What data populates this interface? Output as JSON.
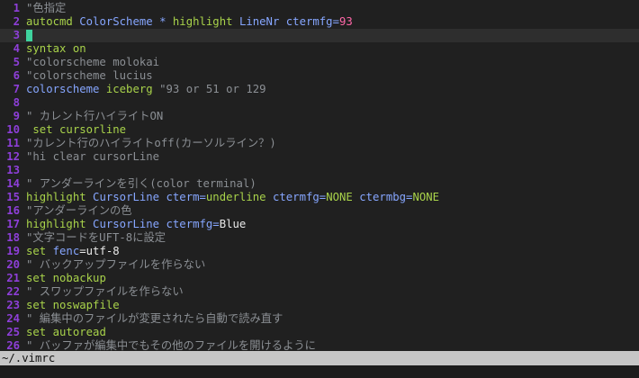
{
  "editor": {
    "lines": [
      [
        {
          "t": "\"色指定",
          "c": "t-c"
        }
      ],
      [
        {
          "t": "autocmd ",
          "c": "t-k"
        },
        {
          "t": "ColorScheme * ",
          "c": "t-h"
        },
        {
          "t": "highlight ",
          "c": "t-k"
        },
        {
          "t": "LineNr ",
          "c": "t-h"
        },
        {
          "t": "ctermfg=",
          "c": "t-h"
        },
        {
          "t": "93",
          "c": "t-v"
        }
      ],
      [],
      [
        {
          "t": "syntax ",
          "c": "t-k"
        },
        {
          "t": "on",
          "c": "t-k"
        }
      ],
      [
        {
          "t": "\"colorscheme molokai",
          "c": "t-c"
        }
      ],
      [
        {
          "t": "\"colorscheme lucius",
          "c": "t-c"
        }
      ],
      [
        {
          "t": "colorscheme ",
          "c": "t-h"
        },
        {
          "t": "iceberg ",
          "c": "t-k"
        },
        {
          "t": "\"93 or 51 or 129",
          "c": "t-c"
        }
      ],
      [],
      [
        {
          "t": "\" カレント行ハイライトON",
          "c": "t-c"
        }
      ],
      [
        {
          "t": " set ",
          "c": "t-k"
        },
        {
          "t": "cursorline",
          "c": "t-k"
        }
      ],
      [
        {
          "t": "\"カレント行のハイライトoff(カーソルライン？)",
          "c": "t-c"
        }
      ],
      [
        {
          "t": "\"hi clear cursorLine",
          "c": "t-c"
        }
      ],
      [],
      [
        {
          "t": "\" アンダーラインを引く(color terminal)",
          "c": "t-c"
        }
      ],
      [
        {
          "t": "highlight ",
          "c": "t-k"
        },
        {
          "t": "CursorLine ",
          "c": "t-h"
        },
        {
          "t": "cterm=",
          "c": "t-h"
        },
        {
          "t": "underline ",
          "c": "t-k"
        },
        {
          "t": "ctermfg=",
          "c": "t-h"
        },
        {
          "t": "NONE ",
          "c": "t-k"
        },
        {
          "t": "ctermbg=",
          "c": "t-h"
        },
        {
          "t": "NONE",
          "c": "t-k"
        }
      ],
      [
        {
          "t": "\"アンダーラインの色",
          "c": "t-c"
        }
      ],
      [
        {
          "t": "highlight ",
          "c": "t-k"
        },
        {
          "t": "CursorLine ",
          "c": "t-h"
        },
        {
          "t": "ctermfg=",
          "c": "t-h"
        },
        {
          "t": "Blue",
          "c": "t-p"
        }
      ],
      [
        {
          "t": "\"文字コードをUFT-8に設定",
          "c": "t-c"
        }
      ],
      [
        {
          "t": "set ",
          "c": "t-k"
        },
        {
          "t": "fenc",
          "c": "t-h"
        },
        {
          "t": "=utf-8",
          "c": "t-p"
        }
      ],
      [
        {
          "t": "\" バックアップファイルを作らない",
          "c": "t-c"
        }
      ],
      [
        {
          "t": "set ",
          "c": "t-k"
        },
        {
          "t": "nobackup",
          "c": "t-k"
        }
      ],
      [
        {
          "t": "\" スワップファイルを作らない",
          "c": "t-c"
        }
      ],
      [
        {
          "t": "set ",
          "c": "t-k"
        },
        {
          "t": "noswapfile",
          "c": "t-k"
        }
      ],
      [
        {
          "t": "\" 編集中のファイルが変更されたら自動で読み直す",
          "c": "t-c"
        }
      ],
      [
        {
          "t": "set ",
          "c": "t-k"
        },
        {
          "t": "autoread",
          "c": "t-k"
        }
      ],
      [
        {
          "t": "\" バッファが編集中でもその他のファイルを開けるように",
          "c": "t-c"
        }
      ]
    ],
    "line_numbers": [
      "1",
      "2",
      "3",
      "4",
      "5",
      "6",
      "7",
      "8",
      "9",
      "10",
      "11",
      "12",
      "13",
      "14",
      "15",
      "16",
      "17",
      "18",
      "19",
      "20",
      "21",
      "22",
      "23",
      "24",
      "25",
      "26"
    ],
    "current_line": 3
  },
  "statusline": {
    "filename": "~/.vimrc"
  },
  "colors": {
    "line_number": "#8e3fd9",
    "cursor": "#3fd39e",
    "comment": "#8b8f94",
    "keyword": "#a8d24a",
    "highlight_group": "#86a6ff",
    "number": "#ff68a8",
    "background": "#202020",
    "statusline_bg": "#c6c6c6"
  }
}
